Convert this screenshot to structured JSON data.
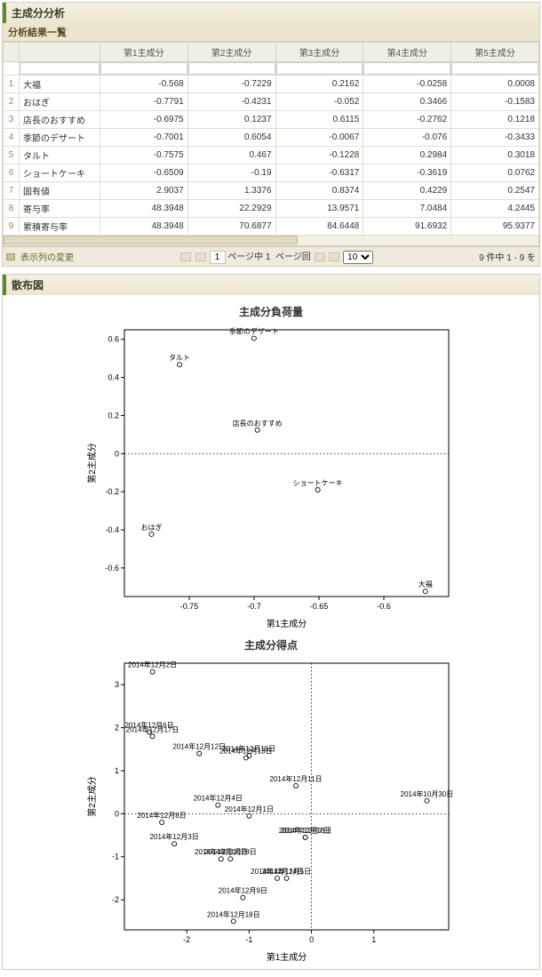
{
  "panel1": {
    "title": "主成分分析",
    "subtitle": "分析結果一覧",
    "columns": [
      "",
      "",
      "第1主成分",
      "第2主成分",
      "第3主成分",
      "第4主成分",
      "第5主成分"
    ],
    "rows": [
      {
        "n": "1",
        "lbl": "大福",
        "v": [
          "-0.568",
          "-0.7229",
          "0.2162",
          "-0.0258",
          "0.0008"
        ]
      },
      {
        "n": "2",
        "lbl": "おはぎ",
        "v": [
          "-0.7791",
          "-0.4231",
          "-0.052",
          "0.3466",
          "-0.1583"
        ]
      },
      {
        "n": "3",
        "lbl": "店長のおすすめ",
        "v": [
          "-0.6975",
          "0.1237",
          "0.6115",
          "-0.2762",
          "0.1218"
        ]
      },
      {
        "n": "4",
        "lbl": "季節のデザート",
        "v": [
          "-0.7001",
          "0.6054",
          "-0.0067",
          "-0.076",
          "-0.3433"
        ]
      },
      {
        "n": "5",
        "lbl": "タルト",
        "v": [
          "-0.7575",
          "0.467",
          "-0.1228",
          "0.2984",
          "0.3018"
        ]
      },
      {
        "n": "6",
        "lbl": "ショートケーキ",
        "v": [
          "-0.6509",
          "-0.19",
          "-0.6317",
          "-0.3619",
          "0.0762"
        ]
      },
      {
        "n": "7",
        "lbl": "固有値",
        "v": [
          "2.9037",
          "1.3376",
          "0.8374",
          "0.4229",
          "0.2547"
        ]
      },
      {
        "n": "8",
        "lbl": "寄与率",
        "v": [
          "48.3948",
          "22.2929",
          "13.9571",
          "7.0484",
          "4.2445"
        ]
      },
      {
        "n": "9",
        "lbl": "累積寄与率",
        "v": [
          "48.3948",
          "70.6877",
          "84.6448",
          "91.6932",
          "95.9377"
        ]
      }
    ],
    "footer": {
      "changeCols": "表示列の変更",
      "pageOf": "ページ中",
      "pageNum": "1",
      "pageTimes": "ページ回",
      "perPage": "10",
      "countText": "9 件中 1 - 9 を"
    }
  },
  "panel2": {
    "title": "散布図",
    "chart1_title": "主成分負荷量",
    "chart2_title": "主成分得点",
    "xlabel": "第1主成分",
    "ylabel": "第2主成分"
  },
  "chart_data": [
    {
      "type": "scatter",
      "title": "主成分負荷量",
      "xlabel": "第1主成分",
      "ylabel": "第2主成分",
      "xlim": [
        -0.8,
        -0.55
      ],
      "ylim": [
        -0.75,
        0.65
      ],
      "xticks": [
        -0.75,
        -0.7,
        -0.65,
        -0.6
      ],
      "yticks": [
        -0.6,
        -0.4,
        -0.2,
        0.0,
        0.2,
        0.4,
        0.6
      ],
      "points": [
        {
          "label": "季節のデザート",
          "x": -0.7001,
          "y": 0.6054
        },
        {
          "label": "タルト",
          "x": -0.7575,
          "y": 0.467
        },
        {
          "label": "店長のおすすめ",
          "x": -0.6975,
          "y": 0.1237
        },
        {
          "label": "ショートケーキ",
          "x": -0.6509,
          "y": -0.19
        },
        {
          "label": "おはぎ",
          "x": -0.7791,
          "y": -0.4231
        },
        {
          "label": "大福",
          "x": -0.568,
          "y": -0.7229
        }
      ]
    },
    {
      "type": "scatter",
      "title": "主成分得点",
      "xlabel": "第1主成分",
      "ylabel": "第2主成分",
      "xlim": [
        -3.0,
        2.2
      ],
      "ylim": [
        -2.7,
        3.5
      ],
      "xticks": [
        -2,
        -1,
        0,
        1
      ],
      "yticks": [
        -2,
        -1,
        0,
        1,
        2,
        3
      ],
      "points": [
        {
          "label": "2014年12月2日",
          "x": -2.55,
          "y": 3.3
        },
        {
          "label": "2014年12月17日",
          "x": -2.55,
          "y": 1.8
        },
        {
          "label": "2014年12月6日",
          "x": -2.6,
          "y": 1.9
        },
        {
          "label": "2014年12月12日",
          "x": -1.8,
          "y": 1.4
        },
        {
          "label": "2014年12月13日",
          "x": -1.05,
          "y": 1.3
        },
        {
          "label": "2014年12月15日",
          "x": -1.0,
          "y": 1.35
        },
        {
          "label": "2014年12月11日",
          "x": -0.25,
          "y": 0.65
        },
        {
          "label": "2014年10月30日",
          "x": 1.85,
          "y": 0.3
        },
        {
          "label": "2014年12月4日",
          "x": -1.5,
          "y": 0.2
        },
        {
          "label": "2014年12月1日",
          "x": -1.0,
          "y": -0.05
        },
        {
          "label": "2014年12月8日",
          "x": -2.4,
          "y": -0.2
        },
        {
          "label": "2014年12月7日",
          "x": -0.1,
          "y": -0.55
        },
        {
          "label": "2014年12月16日",
          "x": -0.1,
          "y": -0.55
        },
        {
          "label": "2014年12月3日",
          "x": -2.2,
          "y": -0.7
        },
        {
          "label": "2014年12月10日",
          "x": -1.45,
          "y": -1.05
        },
        {
          "label": "2014年11月28日",
          "x": -1.3,
          "y": -1.05
        },
        {
          "label": "2014年12月5日",
          "x": -0.4,
          "y": -1.5
        },
        {
          "label": "2014年12月14日",
          "x": -0.55,
          "y": -1.5
        },
        {
          "label": "2014年12月9日",
          "x": -1.1,
          "y": -1.95
        },
        {
          "label": "2014年12月18日",
          "x": -1.25,
          "y": -2.5
        }
      ]
    }
  ]
}
